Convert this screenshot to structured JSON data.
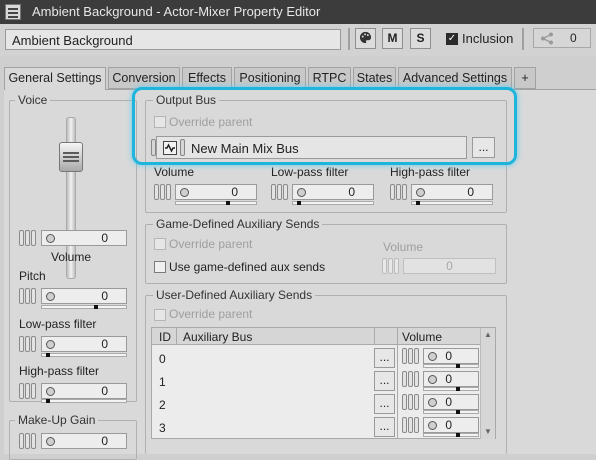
{
  "window": {
    "title": "Ambient Background - Actor-Mixer Property Editor"
  },
  "toolbar": {
    "object_name": "Ambient Background",
    "btn_m": "M",
    "btn_s": "S",
    "inclusion_label": "Inclusion",
    "inclusion_checked": true,
    "reference_count": "0"
  },
  "tabs": [
    "General Settings",
    "Conversion",
    "Effects",
    "Positioning",
    "RTPC",
    "States",
    "Advanced Settings",
    "+"
  ],
  "voice": {
    "group_label": "Voice",
    "volume_label": "Volume",
    "volume_value": "0",
    "pitch_label": "Pitch",
    "pitch_value": "0",
    "lpf_label": "Low-pass filter",
    "lpf_value": "0",
    "hpf_label": "High-pass filter",
    "hpf_value": "0"
  },
  "makeup_gain": {
    "label": "Make-Up Gain",
    "value": "0"
  },
  "output_bus": {
    "group_label": "Output Bus",
    "override_label": "Override parent",
    "bus_name": "New Main Mix Bus",
    "browse_label": "...",
    "volume_label": "Volume",
    "volume_value": "0",
    "lpf_label": "Low-pass filter",
    "lpf_value": "0",
    "hpf_label": "High-pass filter",
    "hpf_value": "0"
  },
  "game_aux": {
    "group_label": "Game-Defined Auxiliary Sends",
    "override_label": "Override parent",
    "use_label": "Use game-defined aux sends",
    "volume_label": "Volume",
    "volume_value": "0"
  },
  "user_aux": {
    "group_label": "User-Defined Auxiliary Sends",
    "override_label": "Override parent",
    "columns": [
      "ID",
      "Auxiliary Bus",
      "Volume"
    ],
    "rows": [
      {
        "id": "0",
        "browse": "...",
        "volume": "0"
      },
      {
        "id": "1",
        "browse": "...",
        "volume": "0"
      },
      {
        "id": "2",
        "browse": "...",
        "volume": "0"
      },
      {
        "id": "3",
        "browse": "...",
        "volume": "0"
      }
    ]
  }
}
